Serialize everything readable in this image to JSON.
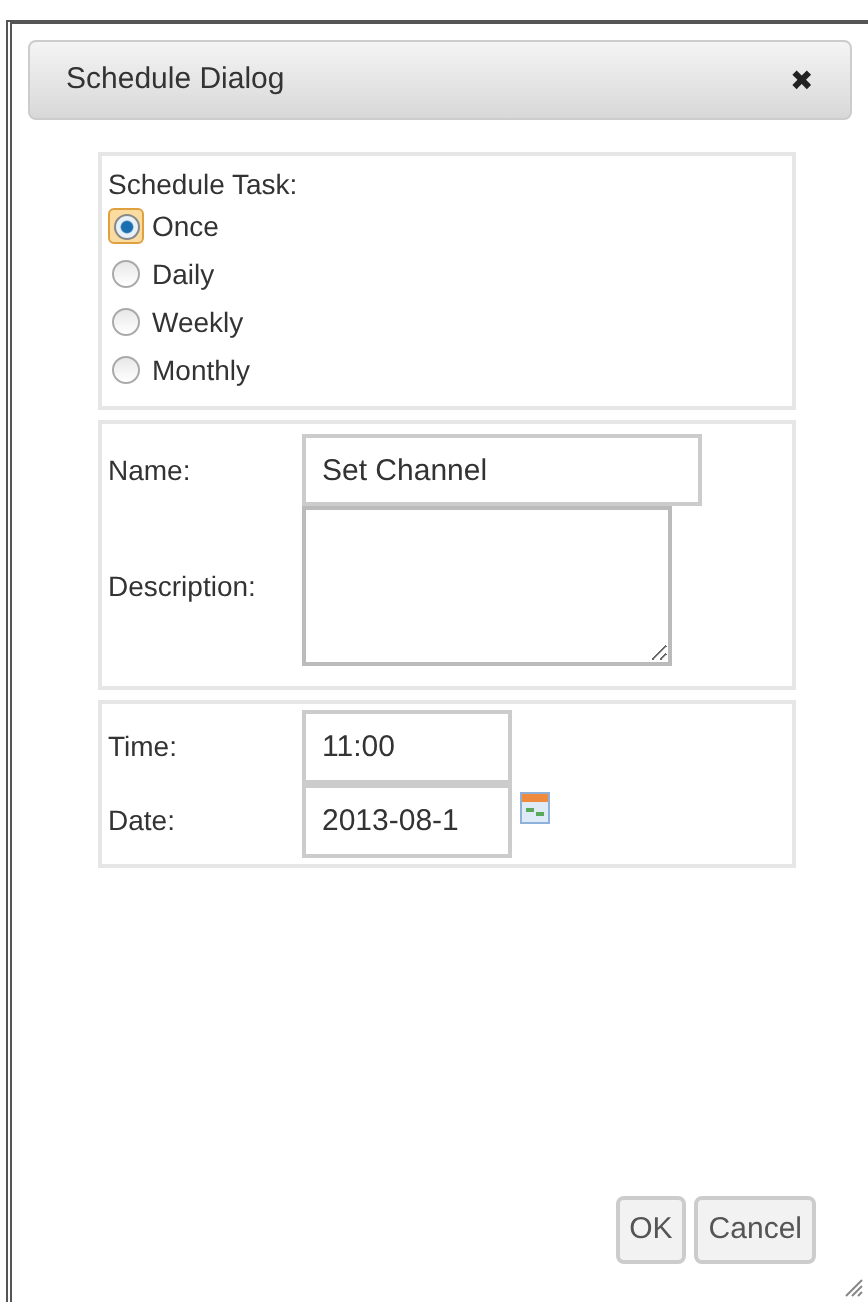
{
  "dialog": {
    "title": "Schedule Dialog",
    "close": "✖"
  },
  "schedule": {
    "label": "Schedule Task:",
    "options": [
      {
        "label": "Once",
        "selected": true
      },
      {
        "label": "Daily",
        "selected": false
      },
      {
        "label": "Weekly",
        "selected": false
      },
      {
        "label": "Monthly",
        "selected": false
      }
    ]
  },
  "name": {
    "label": "Name:",
    "value": "Set Channel"
  },
  "description": {
    "label": "Description:"
  },
  "time": {
    "label": "Time:",
    "value": "11:00"
  },
  "date": {
    "label": "Date:",
    "value": "2013-08-1"
  },
  "buttons": [
    "OK",
    "Cancel"
  ]
}
